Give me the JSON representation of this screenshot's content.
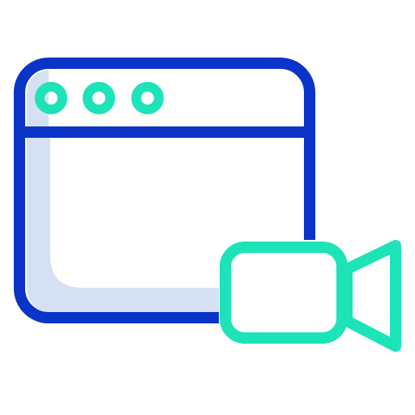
{
  "icon": {
    "name": "browser-video-icon",
    "colors": {
      "window_outline": "#0a34c8",
      "window_shadow": "#d5e0f5",
      "accent": "#1de3b8",
      "background": "#ffffff"
    },
    "parts": {
      "window": "browser-window-icon",
      "dots": [
        "window-dot-icon",
        "window-dot-icon",
        "window-dot-icon"
      ],
      "camera": "video-camera-icon"
    }
  }
}
